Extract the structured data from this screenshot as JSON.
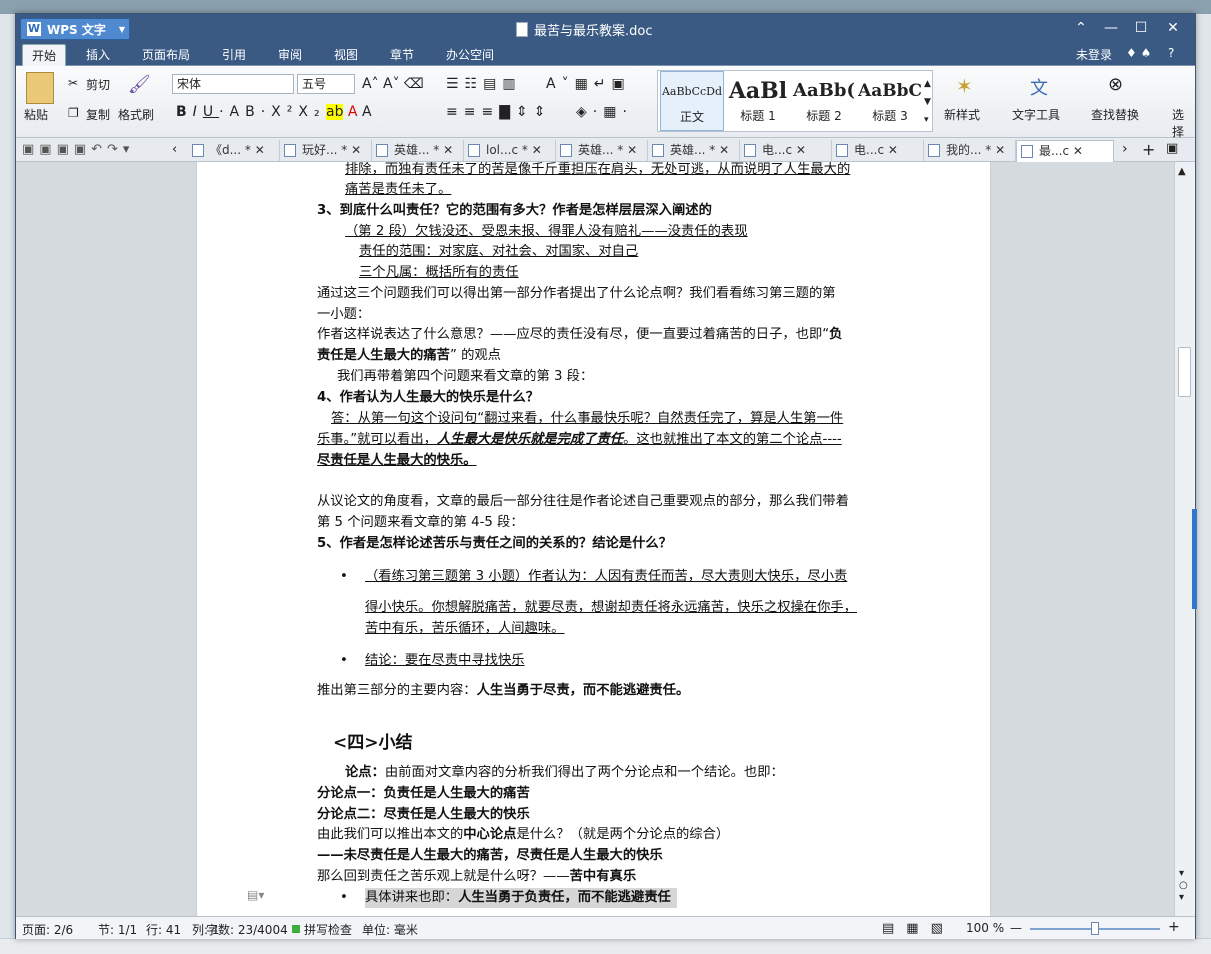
{
  "app": {
    "name": "WPS 文字",
    "doc_title": "最苦与最乐教案.doc"
  },
  "window_controls": {
    "help": "?",
    "min": "—",
    "max": "☐",
    "close": "✕",
    "collapse": "⌃"
  },
  "menu": {
    "tabs": [
      "开始",
      "插入",
      "页面布局",
      "引用",
      "审阅",
      "视图",
      "章节",
      "办公空间"
    ],
    "login": "未登录",
    "help": "?"
  },
  "ribbon": {
    "paste": "粘贴",
    "cut": "剪切",
    "copy": "复制",
    "format_painter": "格式刷",
    "font_name": "宋体",
    "font_size": "五号",
    "styles": [
      {
        "preview": "AaBbCcDd",
        "name": "正文"
      },
      {
        "preview": "AaBl",
        "name": "标题 1"
      },
      {
        "preview": "AaBb(",
        "name": "标题 2"
      },
      {
        "preview": "AaBbC",
        "name": "标题 3"
      }
    ],
    "new_style": "新样式",
    "text_tools": "文字工具",
    "find_replace": "查找替换",
    "select": "选择"
  },
  "doc_tabs": [
    "《d... *",
    "玩好... *",
    "英雄... *",
    "lol...c *",
    "英雄... *",
    "英雄... *",
    "电...c",
    "电...c",
    "我的... *",
    "最...c"
  ],
  "content": {
    "l0": "排除，而独有责任未了的苦是像千斤重担压在肩头，无处可逃，从而说明了人生最大的",
    "l1": "痛苦是责任未了。",
    "l2": "3、到底什么叫责任？它的范围有多大？作者是怎样层层深入阐述的",
    "l3": "（第 2 段）欠钱没还、受恩未报、得罪人没有赔礼——没责任的表现",
    "l4": "责任的范围：对家庭、对社会、对国家、对自己",
    "l5": "三个凡属：概括所有的责任",
    "l6": "通过这三个问题我们可以得出第一部分作者提出了什么论点啊？我们看看练习第三题的第",
    "l7": "一小题：",
    "l8a": "作者这样说表达了什么意思？——应尽的责任没有尽，便一直要过着痛苦的日子，也即“",
    "l8b": "负",
    "l9a": "责任是人生最大的痛苦",
    "l9b": "” 的观点",
    "l10": "我们再带着第四个问题来看文章的第 3 段：",
    "l11": "4、作者认为人生最大的快乐是什么？",
    "l12": "答：从第一句这个设问句“翻过来看，什么事最快乐呢？自然责任完了，算是人生第一件",
    "l13a": "乐事。”就可以看出，",
    "l13b": "人生最大是快乐就是完成了责任",
    "l13c": "。这也就推出了本文的第二个论点----",
    "l14": "尽责任是人生最大的快乐。",
    "l15": "从议论文的角度看，文章的最后一部分往往是作者论述自己重要观点的部分，那么我们带着",
    "l16": "第 5 个问题来看文章的第 4-5 段：",
    "l17": "5、作者是怎样论述苦乐与责任之间的关系的？结论是什么？",
    "l18": "（看练习第三题第 3 小题）作者认为：人因有责任而苦，尽大责则大快乐，尽小责",
    "l19": "得小快乐。你想解脱痛苦，就要尽责，想谢却责任将永远痛苦，快乐之权操在你手，",
    "l20": "苦中有乐，苦乐循环，人间趣味。",
    "l21": "结论：要在尽责中寻找快乐",
    "l22a": "推出第三部分的主要内容：",
    "l22b": "人生当勇于尽责，而不能逃避责任。",
    "l23": "<四>小结",
    "l24a": "论点：",
    "l24b": "由前面对文章内容的分析我们得出了两个分论点和一个结论。也即：",
    "l25": "分论点一：负责任是人生最大的痛苦",
    "l26": "分论点二：尽责任是人生最大的快乐",
    "l27a": "由此我们可以推出本文的",
    "l27b": "中心论点",
    "l27c": "是什么？（就是两个分论点的综合）",
    "l28": "——未尽责任是人生最大的痛苦，尽责任是人生最大的快乐",
    "l29a": "那么回到责任之苦乐观上就是什么呀？——",
    "l29b": "苦中有真乐",
    "l30a": "具体讲来也即：",
    "l30b": "人生当勇于负责任，而不能逃避责任",
    "bullet": "•"
  },
  "status": {
    "page": "页面: 2/6",
    "section": "节: 1/1",
    "row": "行: 41",
    "col": "列: 1",
    "words": "字数: 23/4004",
    "spell": "拼写检查",
    "unit": "单位: 毫米",
    "zoom": "100 %"
  },
  "colors": {
    "title_bar": "#3a5a84",
    "accent": "#4f8ad1",
    "page": "#ffffff"
  }
}
